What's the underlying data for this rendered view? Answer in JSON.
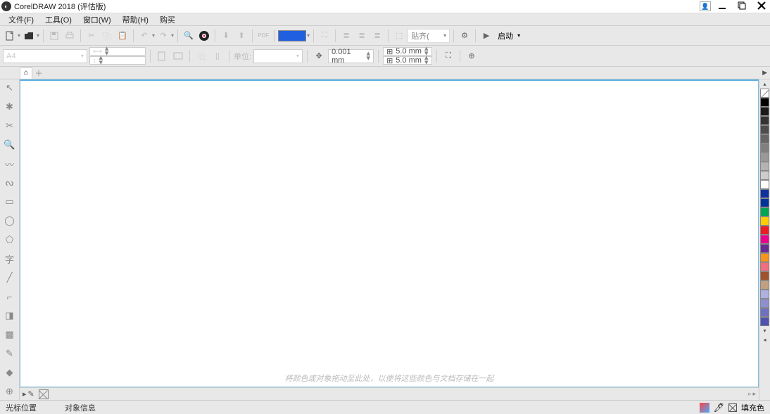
{
  "title": "CorelDRAW 2018 (评估版)",
  "menu": {
    "file": "文件(F)",
    "tools": "工具(O)",
    "window": "窗口(W)",
    "help": "帮助(H)",
    "buy": "购买"
  },
  "toolbar1": {
    "launch_label": "启动"
  },
  "propbar": {
    "pagesize": "A4",
    "units_label": "单位:",
    "nudge_value": "0.001 mm",
    "dup_x": "5.0 mm",
    "dup_y": "5.0 mm"
  },
  "canvas_hint": "将颜色或对象拖动至此处，以便将这些颜色与文档存储在一起",
  "status": {
    "cursor_label": "光标位置",
    "object_label": "对象信息",
    "fill_label": "填充色"
  },
  "palette_colors": [
    "#000000",
    "#1a1a1a",
    "#333333",
    "#4d4d4d",
    "#666666",
    "#808080",
    "#999999",
    "#b3b3b3",
    "#cccccc",
    "#ffffff",
    "#1030a0",
    "#003399",
    "#00a651",
    "#ffcc00",
    "#ed1c24",
    "#ec008c",
    "#662d91",
    "#f7941d",
    "#f26d7d",
    "#a0522d",
    "#c0a080",
    "#b0b0e0",
    "#9090d0",
    "#7070c0",
    "#5050b0"
  ]
}
